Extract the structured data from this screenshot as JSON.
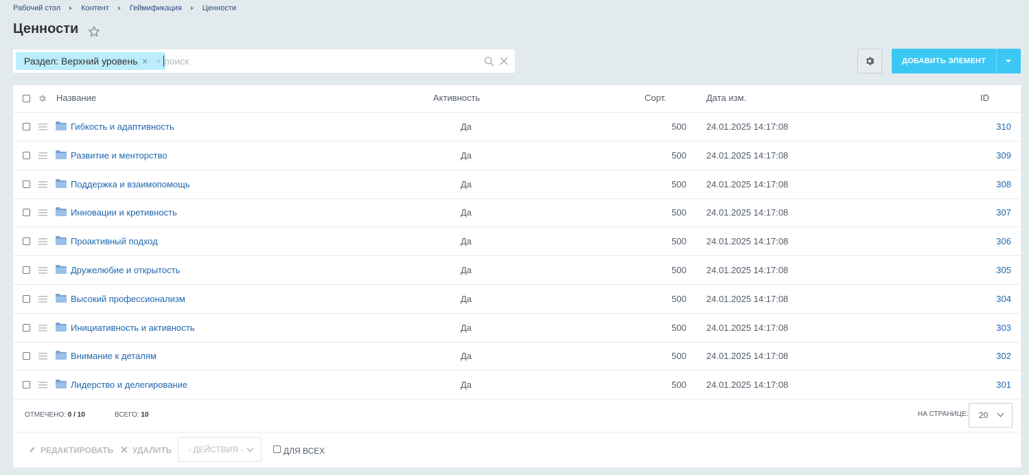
{
  "breadcrumbs": [
    "Рабочий стол",
    "Контент",
    "Геймификация",
    "Ценности"
  ],
  "page_title": "Ценности",
  "filter": {
    "chip_label": "Раздел: Верхний уровень",
    "plus": "+",
    "placeholder": "поиск"
  },
  "toolbar": {
    "add_label": "ДОБАВИТЬ ЭЛЕМЕНТ"
  },
  "columns": {
    "name": "Название",
    "active": "Активность",
    "sort": "Сорт.",
    "date": "Дата изм.",
    "id": "ID"
  },
  "rows": [
    {
      "name": "Гибкость и адаптивность",
      "active": "Да",
      "sort": "500",
      "date": "24.01.2025 14:17:08",
      "id": "310"
    },
    {
      "name": "Развитие и менторство",
      "active": "Да",
      "sort": "500",
      "date": "24.01.2025 14:17:08",
      "id": "309"
    },
    {
      "name": "Поддержка и взаимопомощь",
      "active": "Да",
      "sort": "500",
      "date": "24.01.2025 14:17:08",
      "id": "308"
    },
    {
      "name": "Инновации и кретивность",
      "active": "Да",
      "sort": "500",
      "date": "24.01.2025 14:17:08",
      "id": "307"
    },
    {
      "name": "Проактивный подход",
      "active": "Да",
      "sort": "500",
      "date": "24.01.2025 14:17:08",
      "id": "306"
    },
    {
      "name": "Дружелюбие и открытость",
      "active": "Да",
      "sort": "500",
      "date": "24.01.2025 14:17:08",
      "id": "305"
    },
    {
      "name": "Высокий профессионализм",
      "active": "Да",
      "sort": "500",
      "date": "24.01.2025 14:17:08",
      "id": "304"
    },
    {
      "name": "Инициативность и активность",
      "active": "Да",
      "sort": "500",
      "date": "24.01.2025 14:17:08",
      "id": "303"
    },
    {
      "name": "Внимание к деталям",
      "active": "Да",
      "sort": "500",
      "date": "24.01.2025 14:17:08",
      "id": "302"
    },
    {
      "name": "Лидерство и делегирование",
      "active": "Да",
      "sort": "500",
      "date": "24.01.2025 14:17:08",
      "id": "301"
    }
  ],
  "footer": {
    "selected_label": "ОТМЕЧЕНО:",
    "selected_value": "0 / 10",
    "total_label": "ВСЕГО:",
    "total_value": "10",
    "per_page_label": "НА СТРАНИЦЕ:",
    "per_page_value": "20"
  },
  "actions": {
    "edit": "РЕДАКТИРОВАТЬ",
    "delete": "УДАЛИТЬ",
    "select": "- ДЕЙСТВИЯ -",
    "for_all": "ДЛЯ ВСЕХ"
  },
  "colors": {
    "accent": "#3bc8f5",
    "link": "#2067b0",
    "chip": "#bcedfc",
    "background": "#e2eaee"
  }
}
